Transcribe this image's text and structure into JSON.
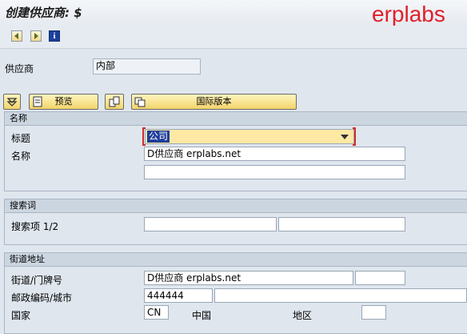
{
  "window": {
    "title": "创建供应商: $",
    "brand": "erplabs"
  },
  "toolbar": {
    "icons": [
      "prev-screen-icon",
      "next-screen-icon",
      "info-icon"
    ],
    "info_glyph": "i"
  },
  "vendor": {
    "label": "供应商",
    "value": "内部"
  },
  "buttons": {
    "collapse_icon": "collapse-icon",
    "preview_label": "预览",
    "international_label": "国际版本"
  },
  "name_group": {
    "header": "名称",
    "title_label": "标题",
    "title_value": "公司",
    "name_label": "名称",
    "name_value": "D供应商 erplabs.net",
    "name2_value": ""
  },
  "search_group": {
    "header": "搜索词",
    "search_label": "搜索项 1/2",
    "search1_value": "",
    "search2_value": ""
  },
  "address_group": {
    "header": "街道地址",
    "street_label": "街道/门牌号",
    "street_value": "D供应商 erplabs.net",
    "house_value": "",
    "postal_label": "邮政编码/城市",
    "postal_value": "444444",
    "city_value": "",
    "country_label": "国家",
    "country_code": "CN",
    "country_name": "中国",
    "region_label": "地区",
    "region_value": ""
  }
}
